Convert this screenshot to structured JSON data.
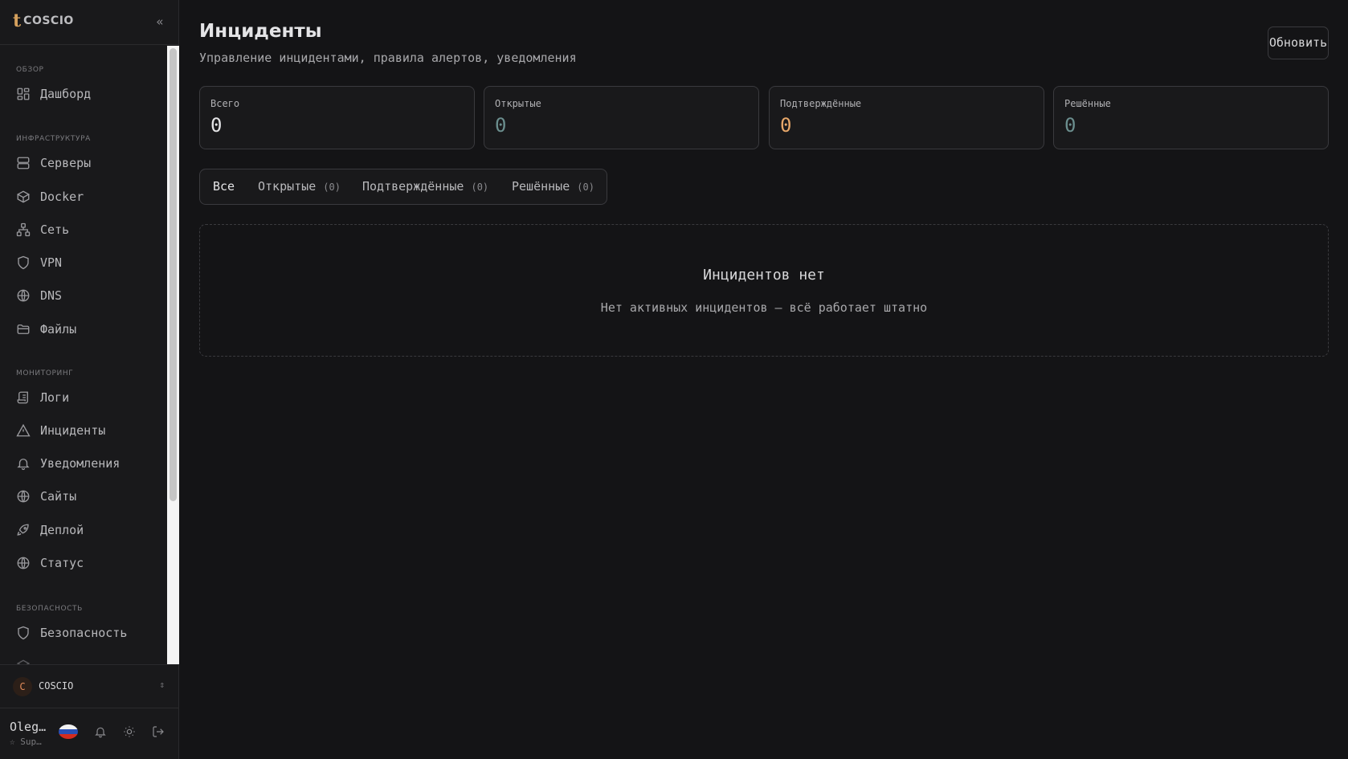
{
  "brand": {
    "name": "COSCIO",
    "mark": "t"
  },
  "sidebar": {
    "sections": [
      {
        "title": "ОБЗОР"
      },
      {
        "title": "ИНФРАСТРУКТУРА"
      },
      {
        "title": "МОНИТОРИНГ"
      },
      {
        "title": "БЕЗОПАСНОСТЬ"
      }
    ],
    "items": [
      {
        "label": "Дашборд",
        "icon": "dashboard-icon"
      },
      {
        "label": "Серверы",
        "icon": "server-icon"
      },
      {
        "label": "Docker",
        "icon": "box-icon"
      },
      {
        "label": "Сеть",
        "icon": "network-icon"
      },
      {
        "label": "VPN",
        "icon": "shield-icon"
      },
      {
        "label": "DNS",
        "icon": "globe-icon"
      },
      {
        "label": "Файлы",
        "icon": "folder-icon"
      },
      {
        "label": "Логи",
        "icon": "scroll-icon"
      },
      {
        "label": "Инциденты",
        "icon": "alert-triangle-icon"
      },
      {
        "label": "Уведомления",
        "icon": "bell-icon"
      },
      {
        "label": "Сайты",
        "icon": "globe-icon"
      },
      {
        "label": "Деплой",
        "icon": "rocket-icon"
      },
      {
        "label": "Статус",
        "icon": "globe-icon"
      },
      {
        "label": "Безопасность",
        "icon": "shield-icon"
      }
    ]
  },
  "org": {
    "initial": "C",
    "name": "COSCIO"
  },
  "user": {
    "name": "Oleg…",
    "role": "Sup…"
  },
  "header": {
    "title": "Инциденты",
    "subtitle": "Управление инцидентами, правила алертов, уведомления",
    "refresh_label": "Обновить"
  },
  "stats": [
    {
      "label": "Всего",
      "value": "0",
      "color": "#e4e4e6"
    },
    {
      "label": "Открытые",
      "value": "0",
      "color": "#6b8e8e"
    },
    {
      "label": "Подтверждённые",
      "value": "0",
      "color": "#e8a86a"
    },
    {
      "label": "Решённые",
      "value": "0",
      "color": "#6b8e8e"
    }
  ],
  "tabs": [
    {
      "label": "Все",
      "count": ""
    },
    {
      "label": "Открытые",
      "count": "(0)"
    },
    {
      "label": "Подтверждённые",
      "count": "(0)"
    },
    {
      "label": "Решённые",
      "count": "(0)"
    }
  ],
  "empty": {
    "title": "Инцидентов нет",
    "subtitle": "Нет активных инцидентов — всё работает штатно"
  }
}
